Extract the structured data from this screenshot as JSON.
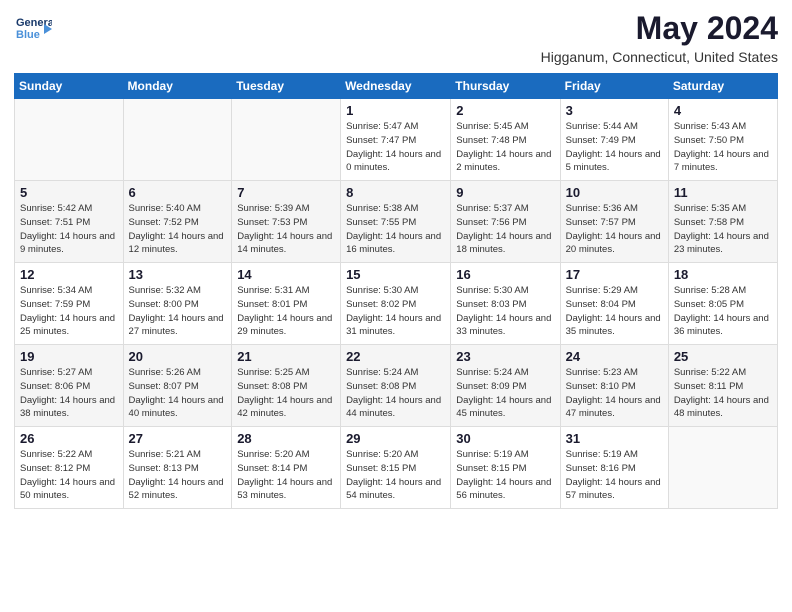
{
  "logo": {
    "line1": "General",
    "line2": "Blue",
    "icon": "▶"
  },
  "title": "May 2024",
  "location": "Higganum, Connecticut, United States",
  "weekdays": [
    "Sunday",
    "Monday",
    "Tuesday",
    "Wednesday",
    "Thursday",
    "Friday",
    "Saturday"
  ],
  "weeks": [
    [
      {
        "day": "",
        "sunrise": "",
        "sunset": "",
        "daylight": ""
      },
      {
        "day": "",
        "sunrise": "",
        "sunset": "",
        "daylight": ""
      },
      {
        "day": "",
        "sunrise": "",
        "sunset": "",
        "daylight": ""
      },
      {
        "day": "1",
        "sunrise": "Sunrise: 5:47 AM",
        "sunset": "Sunset: 7:47 PM",
        "daylight": "Daylight: 14 hours and 0 minutes."
      },
      {
        "day": "2",
        "sunrise": "Sunrise: 5:45 AM",
        "sunset": "Sunset: 7:48 PM",
        "daylight": "Daylight: 14 hours and 2 minutes."
      },
      {
        "day": "3",
        "sunrise": "Sunrise: 5:44 AM",
        "sunset": "Sunset: 7:49 PM",
        "daylight": "Daylight: 14 hours and 5 minutes."
      },
      {
        "day": "4",
        "sunrise": "Sunrise: 5:43 AM",
        "sunset": "Sunset: 7:50 PM",
        "daylight": "Daylight: 14 hours and 7 minutes."
      }
    ],
    [
      {
        "day": "5",
        "sunrise": "Sunrise: 5:42 AM",
        "sunset": "Sunset: 7:51 PM",
        "daylight": "Daylight: 14 hours and 9 minutes."
      },
      {
        "day": "6",
        "sunrise": "Sunrise: 5:40 AM",
        "sunset": "Sunset: 7:52 PM",
        "daylight": "Daylight: 14 hours and 12 minutes."
      },
      {
        "day": "7",
        "sunrise": "Sunrise: 5:39 AM",
        "sunset": "Sunset: 7:53 PM",
        "daylight": "Daylight: 14 hours and 14 minutes."
      },
      {
        "day": "8",
        "sunrise": "Sunrise: 5:38 AM",
        "sunset": "Sunset: 7:55 PM",
        "daylight": "Daylight: 14 hours and 16 minutes."
      },
      {
        "day": "9",
        "sunrise": "Sunrise: 5:37 AM",
        "sunset": "Sunset: 7:56 PM",
        "daylight": "Daylight: 14 hours and 18 minutes."
      },
      {
        "day": "10",
        "sunrise": "Sunrise: 5:36 AM",
        "sunset": "Sunset: 7:57 PM",
        "daylight": "Daylight: 14 hours and 20 minutes."
      },
      {
        "day": "11",
        "sunrise": "Sunrise: 5:35 AM",
        "sunset": "Sunset: 7:58 PM",
        "daylight": "Daylight: 14 hours and 23 minutes."
      }
    ],
    [
      {
        "day": "12",
        "sunrise": "Sunrise: 5:34 AM",
        "sunset": "Sunset: 7:59 PM",
        "daylight": "Daylight: 14 hours and 25 minutes."
      },
      {
        "day": "13",
        "sunrise": "Sunrise: 5:32 AM",
        "sunset": "Sunset: 8:00 PM",
        "daylight": "Daylight: 14 hours and 27 minutes."
      },
      {
        "day": "14",
        "sunrise": "Sunrise: 5:31 AM",
        "sunset": "Sunset: 8:01 PM",
        "daylight": "Daylight: 14 hours and 29 minutes."
      },
      {
        "day": "15",
        "sunrise": "Sunrise: 5:30 AM",
        "sunset": "Sunset: 8:02 PM",
        "daylight": "Daylight: 14 hours and 31 minutes."
      },
      {
        "day": "16",
        "sunrise": "Sunrise: 5:30 AM",
        "sunset": "Sunset: 8:03 PM",
        "daylight": "Daylight: 14 hours and 33 minutes."
      },
      {
        "day": "17",
        "sunrise": "Sunrise: 5:29 AM",
        "sunset": "Sunset: 8:04 PM",
        "daylight": "Daylight: 14 hours and 35 minutes."
      },
      {
        "day": "18",
        "sunrise": "Sunrise: 5:28 AM",
        "sunset": "Sunset: 8:05 PM",
        "daylight": "Daylight: 14 hours and 36 minutes."
      }
    ],
    [
      {
        "day": "19",
        "sunrise": "Sunrise: 5:27 AM",
        "sunset": "Sunset: 8:06 PM",
        "daylight": "Daylight: 14 hours and 38 minutes."
      },
      {
        "day": "20",
        "sunrise": "Sunrise: 5:26 AM",
        "sunset": "Sunset: 8:07 PM",
        "daylight": "Daylight: 14 hours and 40 minutes."
      },
      {
        "day": "21",
        "sunrise": "Sunrise: 5:25 AM",
        "sunset": "Sunset: 8:08 PM",
        "daylight": "Daylight: 14 hours and 42 minutes."
      },
      {
        "day": "22",
        "sunrise": "Sunrise: 5:24 AM",
        "sunset": "Sunset: 8:08 PM",
        "daylight": "Daylight: 14 hours and 44 minutes."
      },
      {
        "day": "23",
        "sunrise": "Sunrise: 5:24 AM",
        "sunset": "Sunset: 8:09 PM",
        "daylight": "Daylight: 14 hours and 45 minutes."
      },
      {
        "day": "24",
        "sunrise": "Sunrise: 5:23 AM",
        "sunset": "Sunset: 8:10 PM",
        "daylight": "Daylight: 14 hours and 47 minutes."
      },
      {
        "day": "25",
        "sunrise": "Sunrise: 5:22 AM",
        "sunset": "Sunset: 8:11 PM",
        "daylight": "Daylight: 14 hours and 48 minutes."
      }
    ],
    [
      {
        "day": "26",
        "sunrise": "Sunrise: 5:22 AM",
        "sunset": "Sunset: 8:12 PM",
        "daylight": "Daylight: 14 hours and 50 minutes."
      },
      {
        "day": "27",
        "sunrise": "Sunrise: 5:21 AM",
        "sunset": "Sunset: 8:13 PM",
        "daylight": "Daylight: 14 hours and 52 minutes."
      },
      {
        "day": "28",
        "sunrise": "Sunrise: 5:20 AM",
        "sunset": "Sunset: 8:14 PM",
        "daylight": "Daylight: 14 hours and 53 minutes."
      },
      {
        "day": "29",
        "sunrise": "Sunrise: 5:20 AM",
        "sunset": "Sunset: 8:15 PM",
        "daylight": "Daylight: 14 hours and 54 minutes."
      },
      {
        "day": "30",
        "sunrise": "Sunrise: 5:19 AM",
        "sunset": "Sunset: 8:15 PM",
        "daylight": "Daylight: 14 hours and 56 minutes."
      },
      {
        "day": "31",
        "sunrise": "Sunrise: 5:19 AM",
        "sunset": "Sunset: 8:16 PM",
        "daylight": "Daylight: 14 hours and 57 minutes."
      },
      {
        "day": "",
        "sunrise": "",
        "sunset": "",
        "daylight": ""
      }
    ]
  ]
}
